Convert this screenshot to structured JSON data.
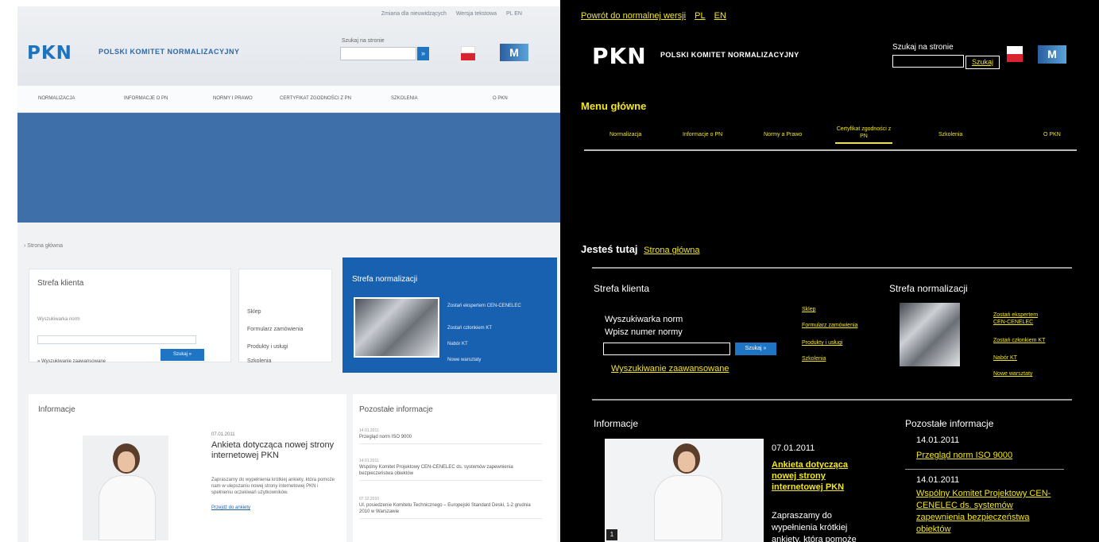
{
  "left": {
    "toplinks": [
      "Zmiana dla nieuwidzących",
      "Wersja tekstowa",
      "PL EN"
    ],
    "logo": "PKN",
    "org_name": "POLSKI KOMITET NORMALIZACYJNY",
    "search_label": "Szukaj na stronie",
    "search_btn": "»",
    "m_logo": "M",
    "nav": [
      "NORMALIZACJA",
      "INFORMACJE O PN",
      "NORMY I PRAWO",
      "CERTYFIKAT ZGODNOŚCI Z PN",
      "SZKOLENIA",
      "O PKN"
    ],
    "breadcrumb": "› Strona główna",
    "client": {
      "title": "Strefa klienta",
      "sub": "Wyszukiwarka norm",
      "btn": "Szukaj »",
      "adv": "» Wyszukiwanie zaawansowane"
    },
    "links": [
      "Sklep",
      "Formularz zamówienia",
      "Produkty i usługi",
      "Szkolenia"
    ],
    "norm": {
      "title": "Strefa normalizacji",
      "items": [
        "Zostań ekspertem CEN-CENELEC",
        "Zostań członkiem KT",
        "Nabór KT",
        "Nowe warsztaty"
      ]
    },
    "info": {
      "title": "Informacje",
      "date": "07.01.2011",
      "headline": "Ankieta dotycząca nowej strony internetowej PKN",
      "text": "Zapraszamy do wypełnienia krótkiej ankiety, która pomoże nam w ulepszaniu nowej strony internetowej PKN i spełnieniu oczekiwań użytkowników.",
      "more": "Przejdź do ankiety"
    },
    "other": {
      "title": "Pozostałe informacje",
      "items": [
        {
          "date": "14.01.2011",
          "text": "Przegląd norm ISO 9000"
        },
        {
          "date": "14.01.2011",
          "text": "Wspólny Komitet Projektowy CEN-CENELEC ds. systemów zapewnienia bezpieczeństwa obiektów"
        },
        {
          "date": "07.12.2010",
          "text": "Ul. posiedzenie Komitetu Technicznego – Europejski Standard Deski, 1-2 grudnia 2010 w Warszawie"
        }
      ]
    }
  },
  "right": {
    "toplinks": [
      "Powrót do normalnej wersji",
      "PL",
      "EN"
    ],
    "logo": "PKN",
    "org_name": "POLSKI KOMITET NORMALIZACYJNY",
    "search_label": "Szukaj na stronie",
    "search_btn": "Szukaj",
    "m_logo": "M",
    "menu_title": "Menu główne",
    "nav": [
      "Normalizacja",
      "Informacje o PN",
      "Normy a Prawo",
      "Certyfikat zgodności z PN",
      "Szkolenia",
      "O PKN"
    ],
    "here_label": "Jesteś tutaj",
    "here_link": "Strona główna",
    "client": {
      "title": "Strefa klienta",
      "line1": "Wyszukiwarka norm",
      "line2": "Wpisz numer normy",
      "btn": "Szukaj »",
      "adv": "Wyszukiwanie zaawansowane"
    },
    "links": [
      "Sklep",
      "Formularz zamówienia",
      "Produkty i usługi",
      "Szkolenia"
    ],
    "norm": {
      "title": "Strefa normalizacji",
      "items": [
        "Zostań ekspertem CEN-CENELEC",
        "Zostań członkiem KT",
        "Nabór KT",
        "Nowe warsztaty"
      ]
    },
    "info": {
      "title": "Informacje",
      "badge": "1",
      "date": "07.01.2011",
      "headline": "Ankieta dotycząca nowej strony internetowej PKN",
      "text": "Zapraszamy do wypełnienia krótkiej ankiety, która pomoże"
    },
    "other": {
      "title": "Pozostałe informacje",
      "items": [
        {
          "date": "14.01.2011",
          "text": "Przegląd norm ISO 9000"
        },
        {
          "date": "14.01.2011",
          "text": "Wspólny Komitet Projektowy CEN-CENELEC ds. systemów zapewnienia bezpieczeństwa obiektów"
        }
      ]
    }
  }
}
